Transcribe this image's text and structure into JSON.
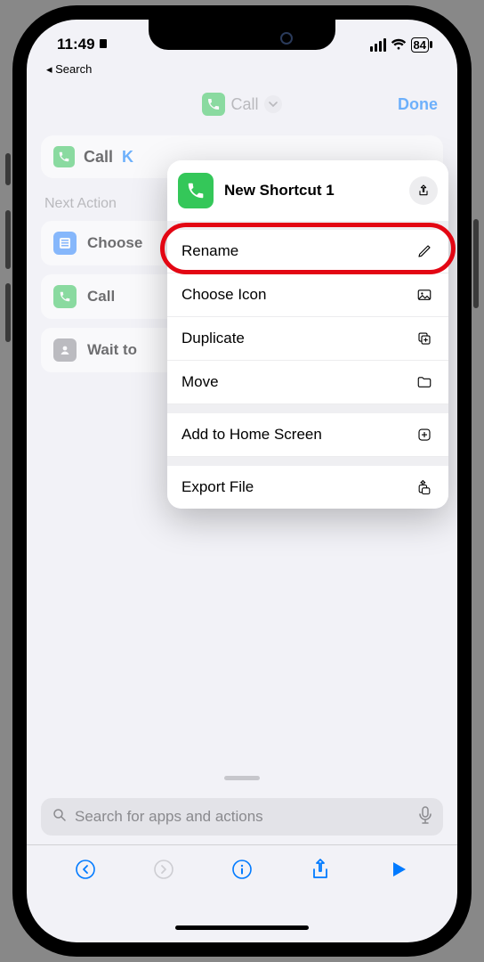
{
  "status": {
    "time": "11:49",
    "battery": "84"
  },
  "back": "Search",
  "header": {
    "title": "Call",
    "done": "Done"
  },
  "card": {
    "label": "Call",
    "fragment": "K"
  },
  "section_label": "Next Action",
  "suggestions": [
    {
      "label": "Choose"
    },
    {
      "label": "Call"
    },
    {
      "label": "Wait to"
    }
  ],
  "popup": {
    "title": "New Shortcut 1",
    "items": [
      {
        "label": "Rename",
        "icon": "pencil"
      },
      {
        "label": "Choose Icon",
        "icon": "picture"
      },
      {
        "label": "Duplicate",
        "icon": "plus-on-square"
      },
      {
        "label": "Move",
        "icon": "folder"
      },
      {
        "label": "Add to Home Screen",
        "icon": "plus-app"
      },
      {
        "label": "Export File",
        "icon": "share-stack"
      }
    ]
  },
  "search": {
    "placeholder": "Search for apps and actions"
  }
}
